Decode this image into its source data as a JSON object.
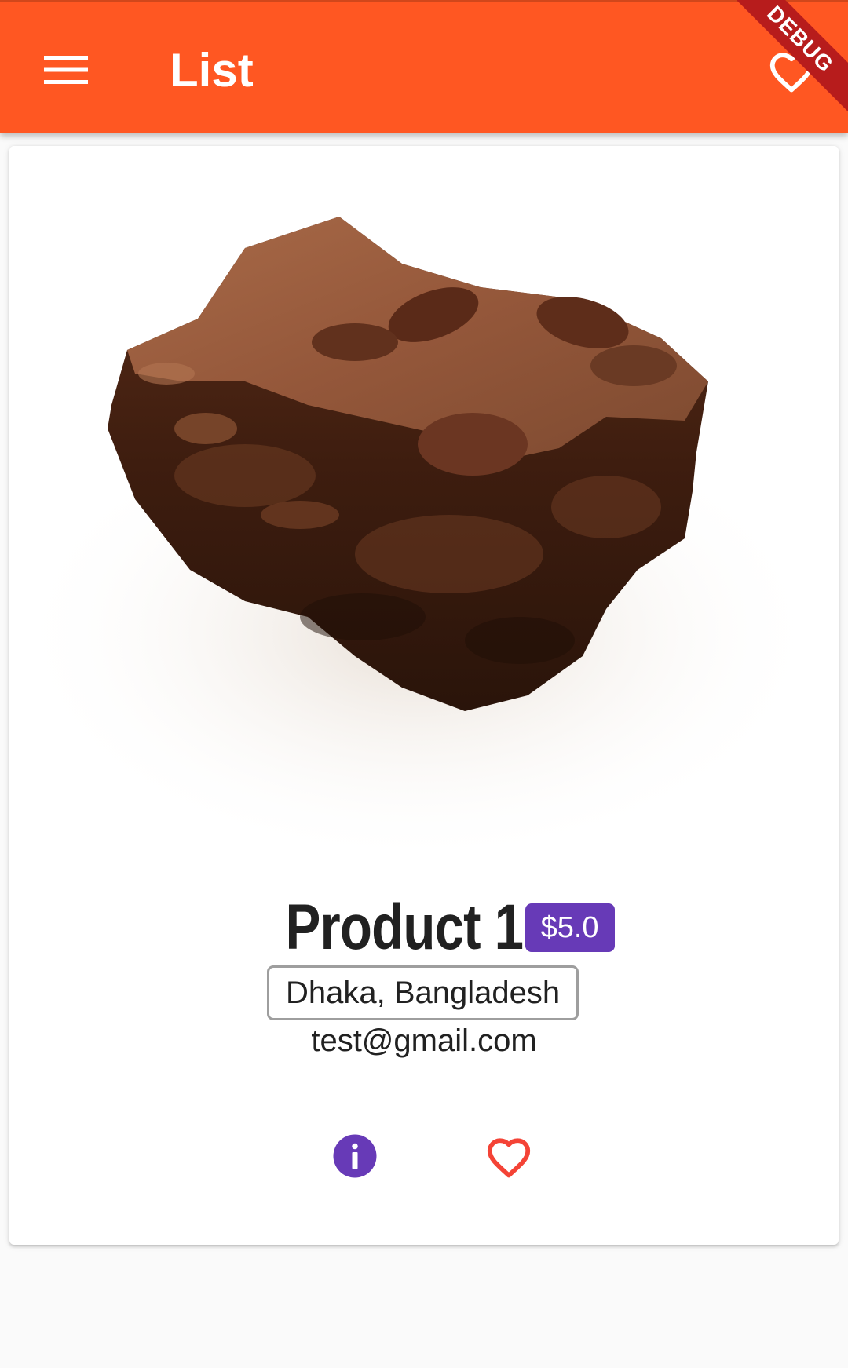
{
  "appbar": {
    "title": "List",
    "background": "#ff5722",
    "menu_icon": "menu-icon",
    "favorite_icon": "heart-outline-icon",
    "debug_banner": "DEBUG"
  },
  "card": {
    "image": "brownie-photo",
    "product_name": "Product 1",
    "price": "$5.0",
    "price_color": "#673ab7",
    "location": "Dhaka, Bangladesh",
    "email": "test@gmail.com",
    "info_icon": "info-icon",
    "info_color": "#673ab7",
    "favorite_icon": "heart-outline-icon",
    "favorite_color": "#f44336"
  }
}
